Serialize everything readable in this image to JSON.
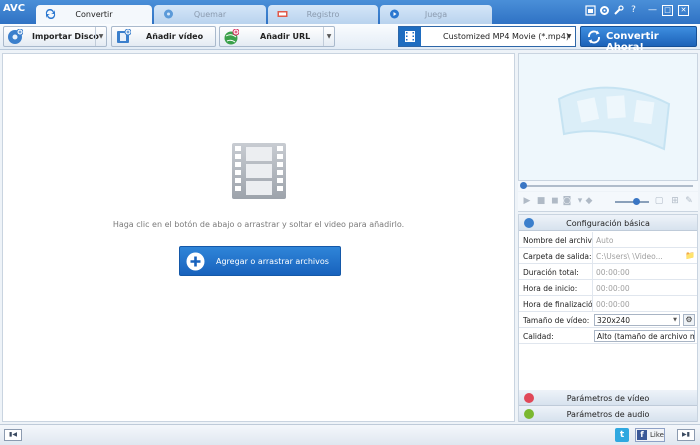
{
  "app": {
    "logo": "AVC"
  },
  "tabs": [
    {
      "label": "Convertir",
      "active": true
    },
    {
      "label": "Quemar",
      "active": false
    },
    {
      "label": "Registro",
      "active": false
    },
    {
      "label": "Juega",
      "active": false
    }
  ],
  "window_controls": {
    "minimize": "—",
    "maximize": "□",
    "close": "✕",
    "help": "?"
  },
  "toolbar": {
    "import_disc": "Importar Disco",
    "add_video": "Añadir vídeo",
    "add_url": "Añadir URL",
    "profile": "Customized MP4 Movie (*.mp4)",
    "convert_now": "Convertir Ahora!"
  },
  "main": {
    "hint": "Haga clic en el botón de abajo o arrastrar y soltar el video para añadirlo.",
    "add_files": "Agregar o arrastrar archivos"
  },
  "settings": {
    "basic_header": "Configuración básica",
    "rows": [
      {
        "key": "Nombre del archivo",
        "value": "Auto"
      },
      {
        "key": "Carpeta de salida:",
        "value": "C:\\Users\\        \\Video..."
      },
      {
        "key": "Duración total:",
        "value": "00:00:00"
      },
      {
        "key": "Hora de inicio:",
        "value": "00:00:00"
      },
      {
        "key": "Hora de finalización",
        "value": "00:00:00"
      },
      {
        "key": "Tamaño de vídeo:",
        "value": "320x240"
      },
      {
        "key": "Calidad:",
        "value": "Alto (tamaño de archivo m..."
      }
    ],
    "video_params": "Parámetros de vídeo",
    "audio_params": "Parámetros de audio"
  },
  "status": {
    "like": "Like",
    "twitter": "t",
    "facebook": "f"
  },
  "colors": {
    "accent": "#1f6dc0",
    "titlebar": "#3a7fcf"
  },
  "icons": {
    "folder": "📁"
  }
}
